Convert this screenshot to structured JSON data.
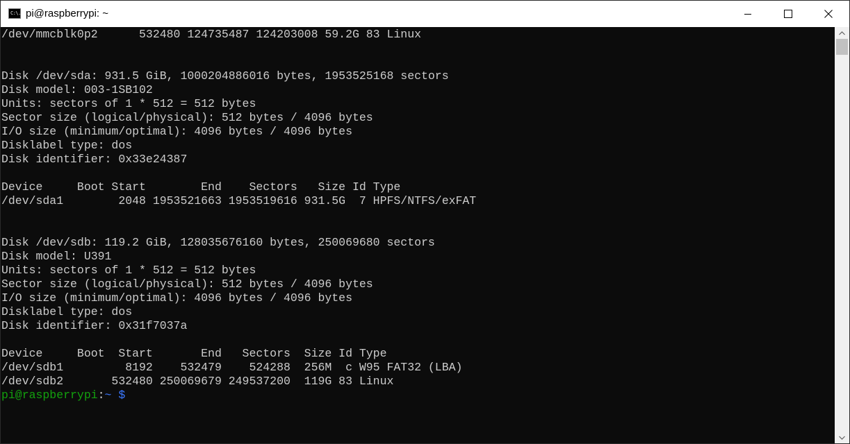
{
  "window": {
    "title": "pi@raspberrypi: ~",
    "app_icon_glyph": "C:\\.",
    "controls": {
      "minimize": "minimize-icon",
      "maximize": "maximize-icon",
      "close": "close-icon"
    }
  },
  "terminal": {
    "colors": {
      "background": "#0c0c0c",
      "text": "#cccccc",
      "prompt_user": "#13a10e",
      "prompt_path": "#3b78ff"
    },
    "lines": [
      "/dev/mmcblk0p2      532480 124735487 124203008 59.2G 83 Linux",
      "",
      "",
      "Disk /dev/sda: 931.5 GiB, 1000204886016 bytes, 1953525168 sectors",
      "Disk model: 003-1SB102",
      "Units: sectors of 1 * 512 = 512 bytes",
      "Sector size (logical/physical): 512 bytes / 4096 bytes",
      "I/O size (minimum/optimal): 4096 bytes / 4096 bytes",
      "Disklabel type: dos",
      "Disk identifier: 0x33e24387",
      "",
      "Device     Boot Start        End    Sectors   Size Id Type",
      "/dev/sda1        2048 1953521663 1953519616 931.5G  7 HPFS/NTFS/exFAT",
      "",
      "",
      "Disk /dev/sdb: 119.2 GiB, 128035676160 bytes, 250069680 sectors",
      "Disk model: U391",
      "Units: sectors of 1 * 512 = 512 bytes",
      "Sector size (logical/physical): 512 bytes / 4096 bytes",
      "I/O size (minimum/optimal): 4096 bytes / 4096 bytes",
      "Disklabel type: dos",
      "Disk identifier: 0x31f7037a",
      "",
      "Device     Boot  Start       End   Sectors  Size Id Type",
      "/dev/sdb1         8192    532479    524288  256M  c W95 FAT32 (LBA)",
      "/dev/sdb2       532480 250069679 249537200  119G 83 Linux"
    ],
    "prompt": {
      "user_host": "pi@raspberrypi",
      "separator": ":",
      "path": "~",
      "symbol": "$"
    }
  },
  "scrollbar": {
    "up_icon": "scroll-up-arrow-icon",
    "down_icon": "scroll-down-arrow-icon",
    "thumb_start_fraction": 0.0,
    "thumb_end_fraction": 0.04
  }
}
